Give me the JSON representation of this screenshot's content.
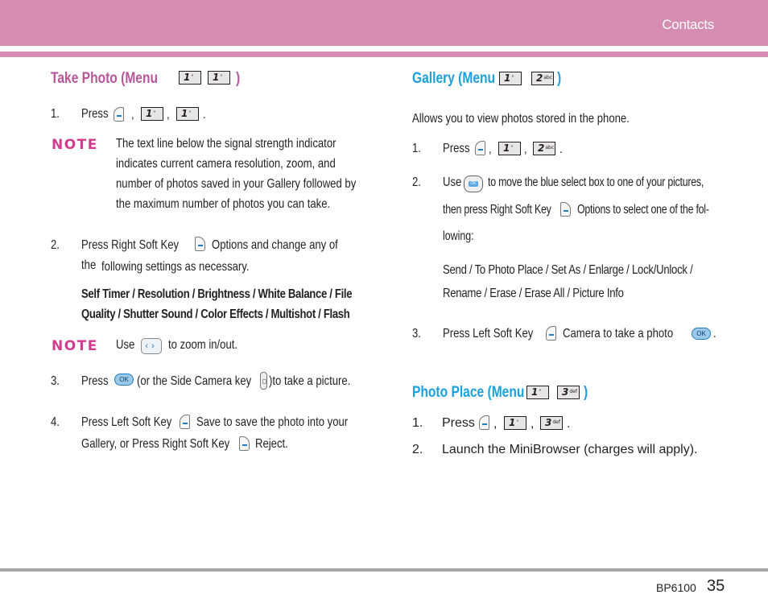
{
  "header": {
    "section_title": "Contacts"
  },
  "left_column": {
    "take_photo": {
      "heading": "Take Photo (Menu",
      "heading_close": ")",
      "menu_keys": [
        "1",
        "1"
      ],
      "step1": {
        "num": "1.",
        "text": "Press",
        "keys": [
          "left-soft-key",
          "1",
          "1"
        ],
        "sep1": ",",
        "sep2": ",",
        "end": "."
      },
      "note1": {
        "label": "NOTE",
        "lines": [
          "The text line below the signal strength indicator",
          "indicates current camera resolution, zoom, and",
          "number of photos saved in your Gallery followed by",
          "the maximum number of photos you can take."
        ]
      },
      "step2": {
        "num": "2.",
        "line1_a": "Press Right Soft Key",
        "line1_b": "Options and change any of",
        "line2_a": "the",
        "line2_b": "following settings as necessary.",
        "options_line1": "Self Timer / Resolution / Brightness / White Balance / File",
        "options_line2": "Quality / Shutter Sound / Color Effects / Multishot / Flash"
      },
      "note2": {
        "label": "NOTE",
        "text_a": "Use",
        "text_b": "to zoom in/out."
      },
      "step3": {
        "num": "3.",
        "text_a": "Press",
        "text_b": "(or the Side Camera key",
        "text_c": ")to take a picture.",
        "ok_label": "OK"
      },
      "step4": {
        "num": "4.",
        "line1_a": "Press Left Soft Key",
        "line1_b": "Save to save the photo into your",
        "line2_a": "Gallery, or Press Right Soft Key",
        "line2_b": "Reject."
      }
    }
  },
  "right_column": {
    "gallery": {
      "heading": "Gallery (Menu",
      "heading_close": ")",
      "menu_keys": [
        "1",
        "2"
      ],
      "intro": "Allows you to view photos stored in the phone.",
      "step1": {
        "num": "1.",
        "text": "Press",
        "sep1": ",",
        "sep2": ",",
        "end": "."
      },
      "step2": {
        "num": "2.",
        "line1_a": "Use",
        "line1_b": "to move the blue select box to one of your pictures,",
        "line2_a": "then press Right Soft Key",
        "line2_b": "Options to select one of the fol-",
        "line3": "lowing:",
        "options_line1": "Send / To Photo Place / Set As / Enlarge / Lock/Unlock /",
        "options_line2": "Rename / Erase /  Erase All / Picture Info"
      },
      "step3": {
        "num": "3.",
        "text_a": "Press Left Soft Key",
        "text_b": "Camera to take a photo",
        "end": ".",
        "ok_label": "OK"
      }
    },
    "photo_place": {
      "heading": "Photo Place (Menu",
      "heading_close": ")",
      "menu_keys": [
        "1",
        "3"
      ],
      "step1": {
        "num": "1.",
        "text": "Press",
        "sep1": ",",
        "sep2": ",",
        "end": "."
      },
      "step2": {
        "num": "2.",
        "text": "Launch the MiniBrowser (charges will apply)."
      }
    }
  },
  "keys": {
    "k1_sub": "°ᵕ",
    "k2_sub": "abc",
    "k3_sub": "def"
  },
  "footer": {
    "model": "BP6100",
    "page_number": "35"
  },
  "colors": {
    "header_pink": "#d58db2",
    "heading_pink": "#b7569a",
    "heading_blue": "#1aa0dc",
    "note_magenta": "#d33b8e"
  }
}
